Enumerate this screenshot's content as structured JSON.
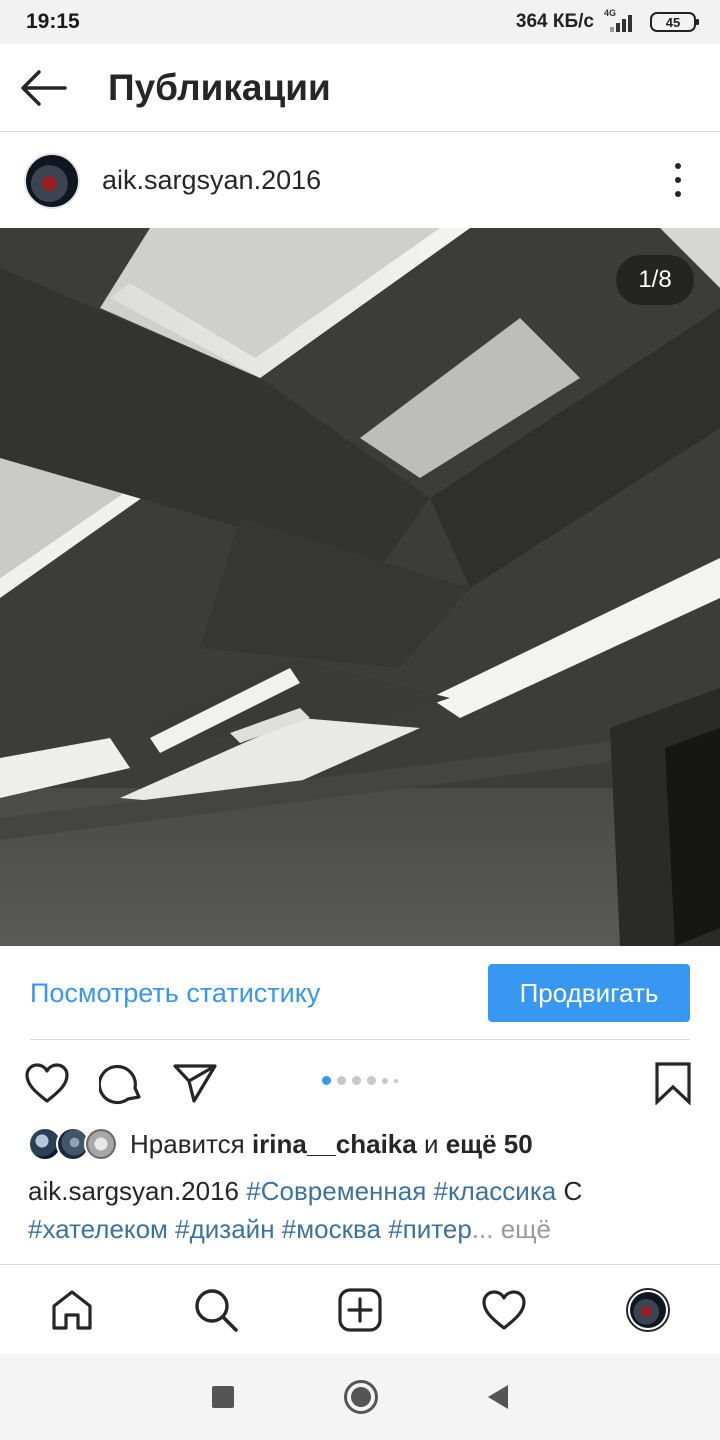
{
  "status_bar": {
    "time": "19:15",
    "speed": "364 КБ/с",
    "network": "4G",
    "battery": "45"
  },
  "header": {
    "back_icon": "arrow-left-icon",
    "title": "Публикации"
  },
  "post": {
    "username": "aik.sargsyan.2016",
    "more_icon": "more-vertical-icon",
    "photo_counter": "1/8",
    "insights_link": "Посмотреть статистику",
    "promote_button": "Продвигать",
    "carousel": {
      "total_dots": 6,
      "active_index": 0
    },
    "likes": {
      "prefix": "Нравится ",
      "user": "irina__chaika",
      "middle": " и ",
      "others": "ещё 50"
    },
    "caption": {
      "username": "aik.sargsyan.2016",
      "tag1": "#Современная",
      "tag2": "#классика",
      "text1": " С ",
      "tag3": "#хателеком",
      "tag4": "#дизайн",
      "tag5": "#москва",
      "tag6": "#питер",
      "ellipsis": "...",
      "more": " ещё"
    }
  },
  "colors": {
    "accent": "#3897f0",
    "hashtag": "#3f729b",
    "text": "#262626"
  },
  "bottom_nav": [
    "home-icon",
    "search-icon",
    "add-post-icon",
    "activity-heart-icon",
    "profile-avatar"
  ]
}
